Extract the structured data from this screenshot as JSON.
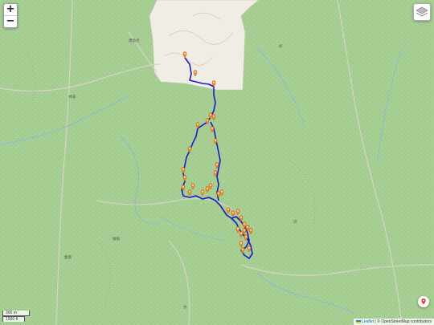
{
  "controls": {
    "zoom_in": "+",
    "zoom_out": "−"
  },
  "icons": {
    "layers": "layers-icon",
    "locate": "location-pin-icon",
    "flag": "flag-icon"
  },
  "scale": {
    "metric": "300 m",
    "imperial": "1000 ft"
  },
  "attribution": {
    "leaflet": "Leaflet",
    "separator": " | © ",
    "osm": "OpenStreetMap contributors"
  },
  "colors": {
    "track": "#1a1acc",
    "marker": "#f08a24",
    "forest": "#a7cf94",
    "urban": "#f0ede4"
  },
  "place_labels": [
    "標高点",
    "峠",
    "林道",
    "沢",
    "尾根",
    "集落",
    "谷"
  ]
}
